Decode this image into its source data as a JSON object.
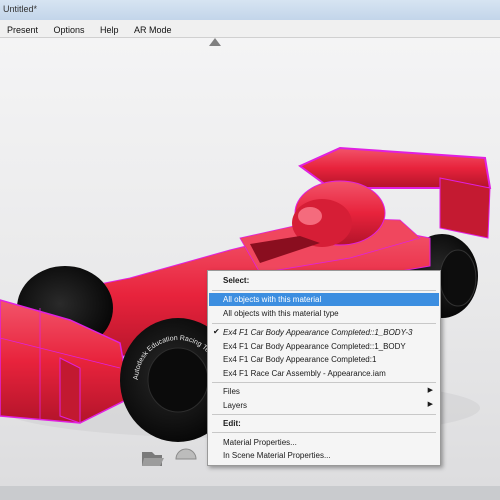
{
  "window": {
    "title": "Untitled*"
  },
  "menubar": {
    "items": [
      "Present",
      "Options",
      "Help",
      "AR Mode"
    ]
  },
  "car": {
    "wheel_text": "Autodesk Education Racing Team",
    "body_color": "#e8233c",
    "edge_color": "#e020e0"
  },
  "context_menu": {
    "header": "Select:",
    "select_items": [
      "All objects with this material",
      "All objects with this material type"
    ],
    "material_items": [
      "Ex4 F1 Car Body Appearance Completed::1_BODY-3",
      "Ex4 F1 Car Body Appearance Completed::1_BODY",
      "Ex4 F1 Car Body Appearance Completed:1",
      "Ex4 F1 Race Car Assembly - Appearance.iam"
    ],
    "submenus": [
      "Files",
      "Layers"
    ],
    "edit_header": "Edit:",
    "edit_items": [
      "Material Properties...",
      "In Scene Material Properties..."
    ]
  },
  "colors": {
    "highlight": "#3c8ee0",
    "accent_magenta": "#e020e0",
    "car_red": "#e8233c"
  }
}
